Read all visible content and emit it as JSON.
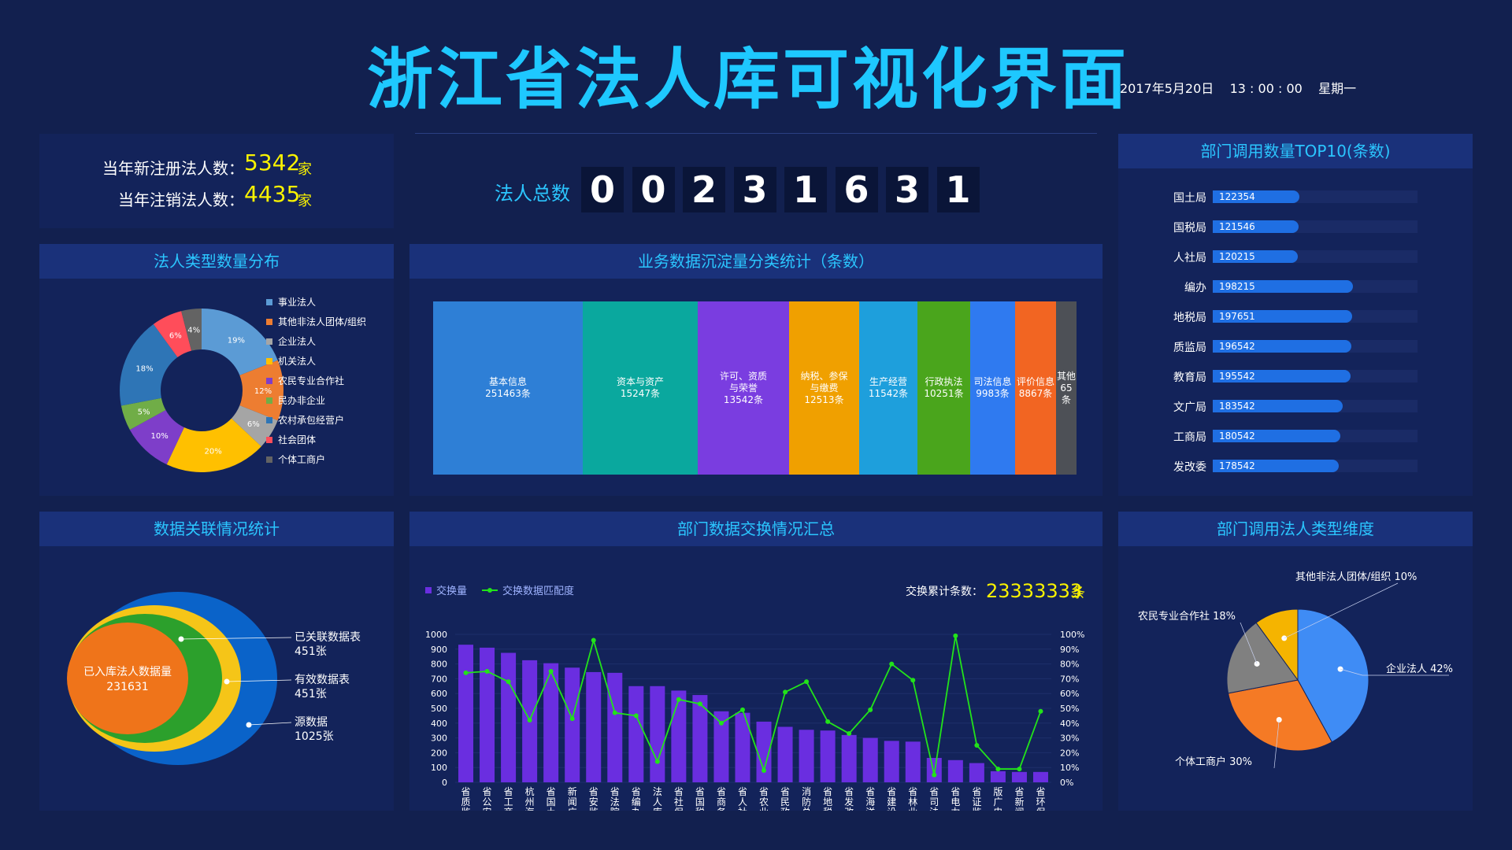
{
  "header": {
    "title": "浙江省法人库可视化界面",
    "datetime": "2017年5月20日    13 : 00 : 00    星期一"
  },
  "stats": {
    "new_label": "当年新注册法人数：",
    "new_value": "5342",
    "cancel_label": "当年注销法人数：",
    "cancel_value": "4435",
    "unit": "家"
  },
  "total": {
    "label": "法人总数",
    "digits": [
      "0",
      "0",
      "2",
      "3",
      "1",
      "6",
      "3",
      "1"
    ]
  },
  "panels": {
    "type_dist": "法人类型数量分布",
    "business": "业务数据沉淀量分类统计（条数）",
    "top10": "部门调用数量TOP10(条数)",
    "relation": "数据关联情况统计",
    "exchange": "部门数据交换情况汇总",
    "dept_type": "部门调用法人类型维度"
  },
  "colors": {
    "bg": "#12204f",
    "panel": "#13235a",
    "accent": "#2bc6ff",
    "yellow": "#f9f200"
  },
  "chart_data": [
    {
      "id": "type_donut",
      "type": "pie",
      "title": "法人类型数量分布",
      "series": [
        {
          "name": "事业法人",
          "value": 19,
          "label": "19%",
          "color": "#5b9bd5"
        },
        {
          "name": "其他非法人团体/组织",
          "value": 12,
          "label": "12%",
          "color": "#ed7d31"
        },
        {
          "name": "企业法人",
          "value": 6,
          "label": "6%",
          "color": "#a5a5a5"
        },
        {
          "name": "机关法人",
          "value": 20,
          "label": "20%",
          "color": "#ffc000"
        },
        {
          "name": "农民专业合作社",
          "value": 10,
          "label": "10%",
          "color": "#7e3ec9"
        },
        {
          "name": "民办非企业",
          "value": 5,
          "label": "5%",
          "color": "#70ad47"
        },
        {
          "name": "农村承包经营户",
          "value": 18,
          "label": "18%",
          "color": "#2e75b6"
        },
        {
          "name": "社会团体",
          "value": 6,
          "label": "6%",
          "color": "#ff4d5a"
        },
        {
          "name": "个体工商户",
          "value": 4,
          "label": "4%",
          "color": "#636363"
        }
      ]
    },
    {
      "id": "business_treemap",
      "type": "bar",
      "title": "业务数据沉淀量分类统计（条数）",
      "items": [
        {
          "name": "基本信息",
          "value_label": "251463条",
          "value": 251463,
          "color": "#2e7fd6"
        },
        {
          "name": "资本与资产",
          "value_label": "15247条",
          "value": 15247,
          "color": "#0aa89e"
        },
        {
          "name": "许可、资质与荣誉",
          "name_lines": [
            "许可、资质",
            "与荣誉"
          ],
          "value_label": "13542条",
          "value": 13542,
          "color": "#7a3de0"
        },
        {
          "name": "纳税、参保与缴费",
          "name_lines": [
            "纳税、参保",
            "与缴费"
          ],
          "value_label": "12513条",
          "value": 12513,
          "color": "#f0a000"
        },
        {
          "name": "生产经营",
          "value_label": "11542条",
          "value": 11542,
          "color": "#1e9fdc"
        },
        {
          "name": "行政执法",
          "value_label": "10251条",
          "value": 10251,
          "color": "#4aa51c"
        },
        {
          "name": "司法信息",
          "value_label": "9983条",
          "value": 9983,
          "color": "#2f7af0"
        },
        {
          "name": "评价信息",
          "value_label": "8867条",
          "value": 8867,
          "color": "#f26522"
        },
        {
          "name": "其他",
          "value_label": "65条",
          "value": 65,
          "color": "#4d5056"
        }
      ]
    },
    {
      "id": "top10_bars",
      "type": "bar",
      "title": "部门调用数量TOP10(条数)",
      "categories": [
        "国土局",
        "国税局",
        "人社局",
        "编办",
        "地税局",
        "质监局",
        "教育局",
        "文广局",
        "工商局",
        "发改委"
      ],
      "values": [
        122354,
        121546,
        120215,
        198215,
        197651,
        196542,
        195542,
        183542,
        180542,
        178542
      ]
    },
    {
      "id": "relation_ellipses",
      "type": "pie",
      "title": "数据关联情况统计",
      "items": [
        {
          "name": "源数据",
          "value_label": "1025张",
          "value": 1025,
          "color": "#0a63c9"
        },
        {
          "name": "有效数据表",
          "value_label": "451张",
          "value": 451,
          "color": "#f5c518"
        },
        {
          "name": "已关联数据表",
          "value_label": "451张",
          "value": 451,
          "color": "#2ca02c"
        },
        {
          "name": "已入库法人数据量",
          "value_label": "231631",
          "value": 231631,
          "color": "#ef741a"
        }
      ]
    },
    {
      "id": "exchange_combo",
      "type": "bar",
      "title": "部门数据交换情况汇总",
      "legend": [
        "交换量",
        "交换数据匹配度"
      ],
      "total_label": "交换累计条数：",
      "total_value": "23333333",
      "total_unit": "条",
      "categories": [
        "省质监局",
        "省公安厅",
        "省工商局",
        "杭州海关",
        "省国土厅",
        "新闻广电局",
        "省安监局",
        "省法院",
        "省编办",
        "法人库编码",
        "省社保局",
        "省国税局",
        "省商务厅",
        "省人社厅",
        "省农业厅",
        "省民政厅",
        "消防总队",
        "省地税局",
        "省发改委",
        "省海洋局",
        "省建设厅",
        "省林业厅",
        "省司法厅",
        "省电力局",
        "省证监局",
        "版广电局",
        "省新闻出",
        "省环保厅"
      ],
      "series": [
        {
          "name": "交换量",
          "values": [
            930,
            910,
            875,
            825,
            805,
            775,
            745,
            740,
            650,
            650,
            620,
            590,
            480,
            470,
            410,
            375,
            355,
            350,
            320,
            300,
            280,
            275,
            165,
            150,
            130,
            75,
            70,
            70
          ]
        },
        {
          "name": "交换数据匹配度",
          "values": [
            74,
            75,
            68,
            42,
            75,
            43,
            96,
            47,
            45,
            14,
            56,
            53,
            40,
            49,
            8,
            61,
            68,
            41,
            33,
            49,
            80,
            69,
            5,
            99,
            25,
            9,
            9,
            48
          ]
        }
      ],
      "y_left": {
        "ticks": [
          "0",
          "100",
          "200",
          "300",
          "400",
          "500",
          "600",
          "700",
          "800",
          "900",
          "1000"
        ],
        "range": [
          0,
          1000
        ]
      },
      "y_right": {
        "ticks": [
          "0%",
          "10%",
          "20%",
          "30%",
          "40%",
          "50%",
          "60%",
          "70%",
          "80%",
          "90%",
          "100%"
        ],
        "range": [
          0,
          100
        ]
      }
    },
    {
      "id": "dept_type_pie",
      "type": "pie",
      "title": "部门调用法人类型维度",
      "series": [
        {
          "name": "企业法人",
          "value": 42,
          "label": "企业法人 42%",
          "color": "#3f8cf5"
        },
        {
          "name": "个体工商户",
          "value": 30,
          "label": "个体工商户 30%",
          "color": "#f57a25"
        },
        {
          "name": "农民专业合作社",
          "value": 18,
          "label": "农民专业合作社 18%",
          "color": "#808080"
        },
        {
          "name": "其他非法人团体/组织",
          "value": 10,
          "label": "其他非法人团体/组织 10%",
          "color": "#f5b400"
        }
      ]
    }
  ]
}
